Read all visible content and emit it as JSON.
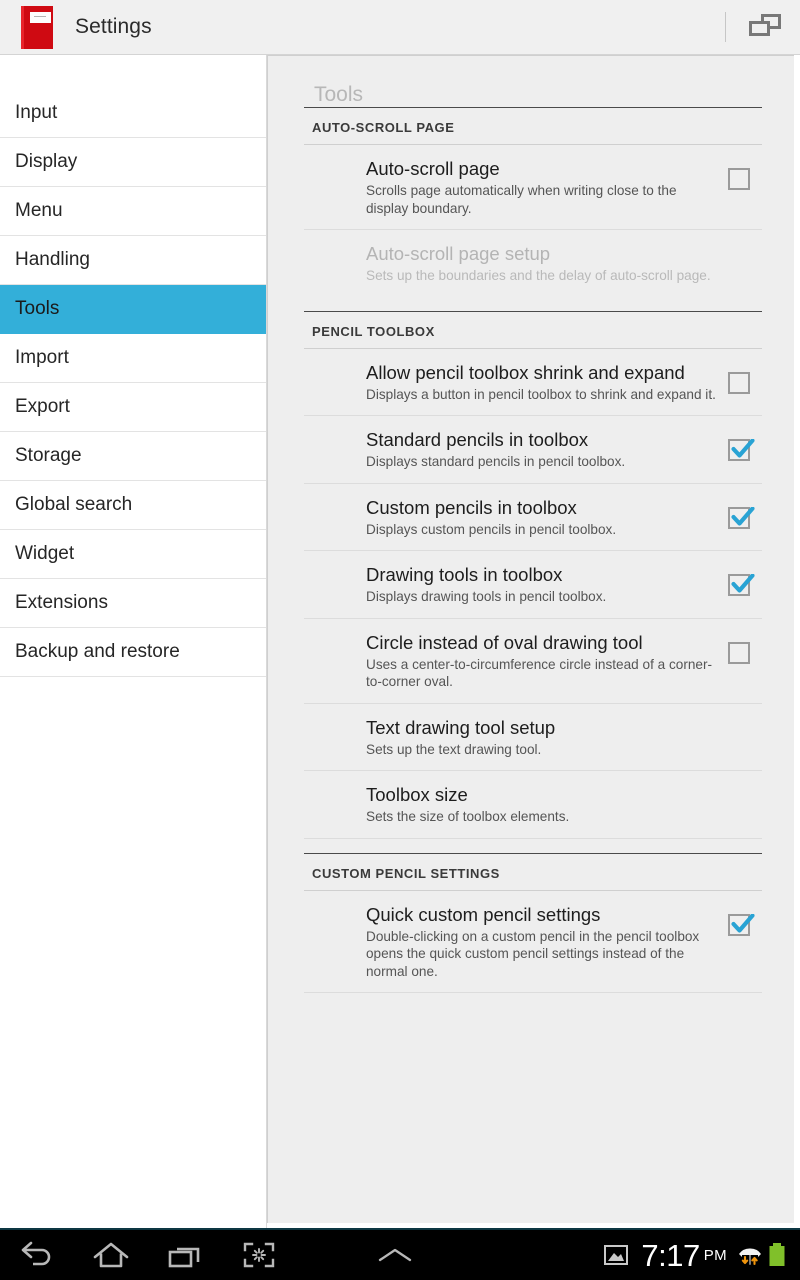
{
  "titlebar": {
    "app_title": "Settings",
    "app_icon": "red-notebook-icon",
    "window_icon": "multi-window-icon",
    "divider": "vertical-divider"
  },
  "sidebar": {
    "items": [
      {
        "label": "Input",
        "selected": false
      },
      {
        "label": "Display",
        "selected": false
      },
      {
        "label": "Menu",
        "selected": false
      },
      {
        "label": "Handling",
        "selected": false
      },
      {
        "label": "Tools",
        "selected": true
      },
      {
        "label": "Import",
        "selected": false
      },
      {
        "label": "Export",
        "selected": false
      },
      {
        "label": "Storage",
        "selected": false
      },
      {
        "label": "Global search",
        "selected": false
      },
      {
        "label": "Widget",
        "selected": false
      },
      {
        "label": "Extensions",
        "selected": false
      },
      {
        "label": "Backup and restore",
        "selected": false
      }
    ]
  },
  "content": {
    "page_title": "Tools",
    "sections": [
      {
        "header": "AUTO-SCROLL PAGE",
        "rows": [
          {
            "title": "Auto-scroll page",
            "summary": "Scrolls page automatically when writing close to the display boundary.",
            "control": "checkbox",
            "checked": false,
            "disabled": false
          },
          {
            "title": "Auto-scroll page setup",
            "summary": "Sets up the boundaries and the delay of auto-scroll page.",
            "control": "none",
            "checked": false,
            "disabled": true
          }
        ]
      },
      {
        "header": "PENCIL TOOLBOX",
        "rows": [
          {
            "title": "Allow pencil toolbox shrink and expand",
            "summary": "Displays a button in pencil toolbox to shrink and expand it.",
            "control": "checkbox",
            "checked": false,
            "disabled": false
          },
          {
            "title": "Standard pencils in toolbox",
            "summary": "Displays standard pencils in pencil toolbox.",
            "control": "checkbox",
            "checked": true,
            "disabled": false
          },
          {
            "title": "Custom pencils in toolbox",
            "summary": "Displays custom pencils in pencil toolbox.",
            "control": "checkbox",
            "checked": true,
            "disabled": false
          },
          {
            "title": "Drawing tools in toolbox",
            "summary": "Displays drawing tools in pencil toolbox.",
            "control": "checkbox",
            "checked": true,
            "disabled": false
          },
          {
            "title": "Circle instead of oval drawing tool",
            "summary": "Uses a center-to-circumference circle instead of a corner-to-corner oval.",
            "control": "checkbox",
            "checked": false,
            "disabled": false
          },
          {
            "title": "Text drawing tool setup",
            "summary": "Sets up the text drawing tool.",
            "control": "none",
            "checked": false,
            "disabled": false
          },
          {
            "title": "Toolbox size",
            "summary": "Sets the size of toolbox elements.",
            "control": "none",
            "checked": false,
            "disabled": false
          }
        ]
      },
      {
        "header": "CUSTOM PENCIL SETTINGS",
        "rows": [
          {
            "title": "Quick custom pencil settings",
            "summary": "Double-clicking on a custom pencil in the pencil toolbox opens the quick custom pencil settings instead of the normal one.",
            "control": "checkbox",
            "checked": true,
            "disabled": false
          }
        ]
      }
    ]
  },
  "navbar": {
    "buttons": [
      {
        "icon": "back-icon"
      },
      {
        "icon": "home-icon"
      },
      {
        "icon": "recent-apps-icon"
      },
      {
        "icon": "screenshot-capture-icon"
      },
      {
        "icon": "chevron-up-icon"
      }
    ],
    "status": {
      "screenshot_icon": "image-icon",
      "time": "7:17",
      "meridiem": "PM",
      "wifi_icon": "wifi-activity-icon",
      "battery_icon": "battery-full-icon"
    }
  },
  "colors": {
    "accent_blue": "#33afd9",
    "check_blue": "#29a3d4",
    "app_red": "#cf0a12",
    "battery_green": "#80c02a",
    "wifi_arrow_orange": "#f0940b",
    "titlebar_bg": "#f0f0f0",
    "content_bg": "#eeeeee"
  }
}
